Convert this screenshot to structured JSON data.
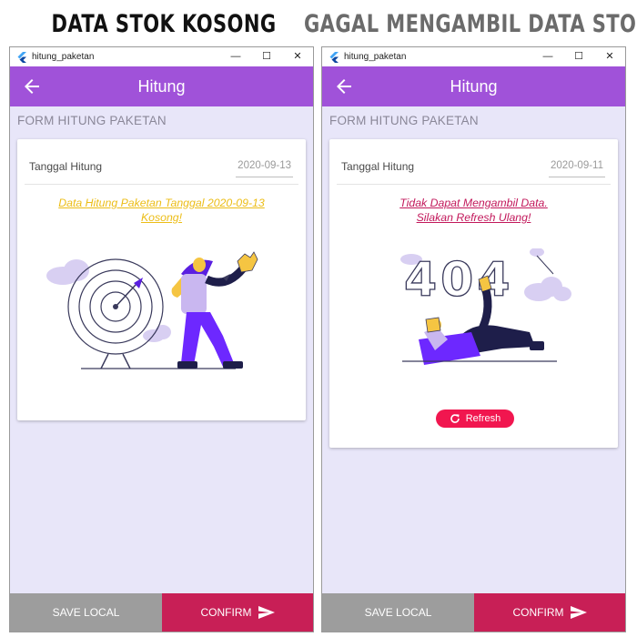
{
  "captions": {
    "left": "DATA STOK KOSONG",
    "right": "GAGAL MENGAMBIL DATA STOK"
  },
  "windows": [
    {
      "app_title": "hitung_paketan",
      "controls": {
        "minimize": "—",
        "maximize": "☐",
        "close": "✕"
      },
      "appbar_title": "Hitung",
      "section_title": "FORM HITUNG PAKETAN",
      "field_label": "Tanggal Hitung",
      "field_value": "2020-09-13",
      "message_line1": "Data Hitung Paketan Tanggal 2020-09-13",
      "message_line2": "Kosong!",
      "save_label": "SAVE LOCAL",
      "confirm_label": "CONFIRM"
    },
    {
      "app_title": "hitung_paketan",
      "controls": {
        "minimize": "—",
        "maximize": "☐",
        "close": "✕"
      },
      "appbar_title": "Hitung",
      "section_title": "FORM HITUNG PAKETAN",
      "field_label": "Tanggal Hitung",
      "field_value": "2020-09-11",
      "message_line1": "Tidak Dapat Mengambil Data.",
      "message_line2": "Silakan Refresh Ulang!",
      "refresh_label": "Refresh",
      "save_label": "SAVE LOCAL",
      "confirm_label": "CONFIRM"
    }
  ],
  "colors": {
    "appbar": "#a052d9",
    "background": "#e8e6f9",
    "empty_message": "#ecbd16",
    "error_message": "#c2185b",
    "refresh_button": "#f1164f",
    "confirm_button": "#c81f56",
    "save_button": "#9d9d9d"
  },
  "icons": {
    "app": "flutter-logo-icon",
    "back": "arrow-left-icon",
    "refresh": "refresh-icon",
    "send": "send-icon"
  }
}
